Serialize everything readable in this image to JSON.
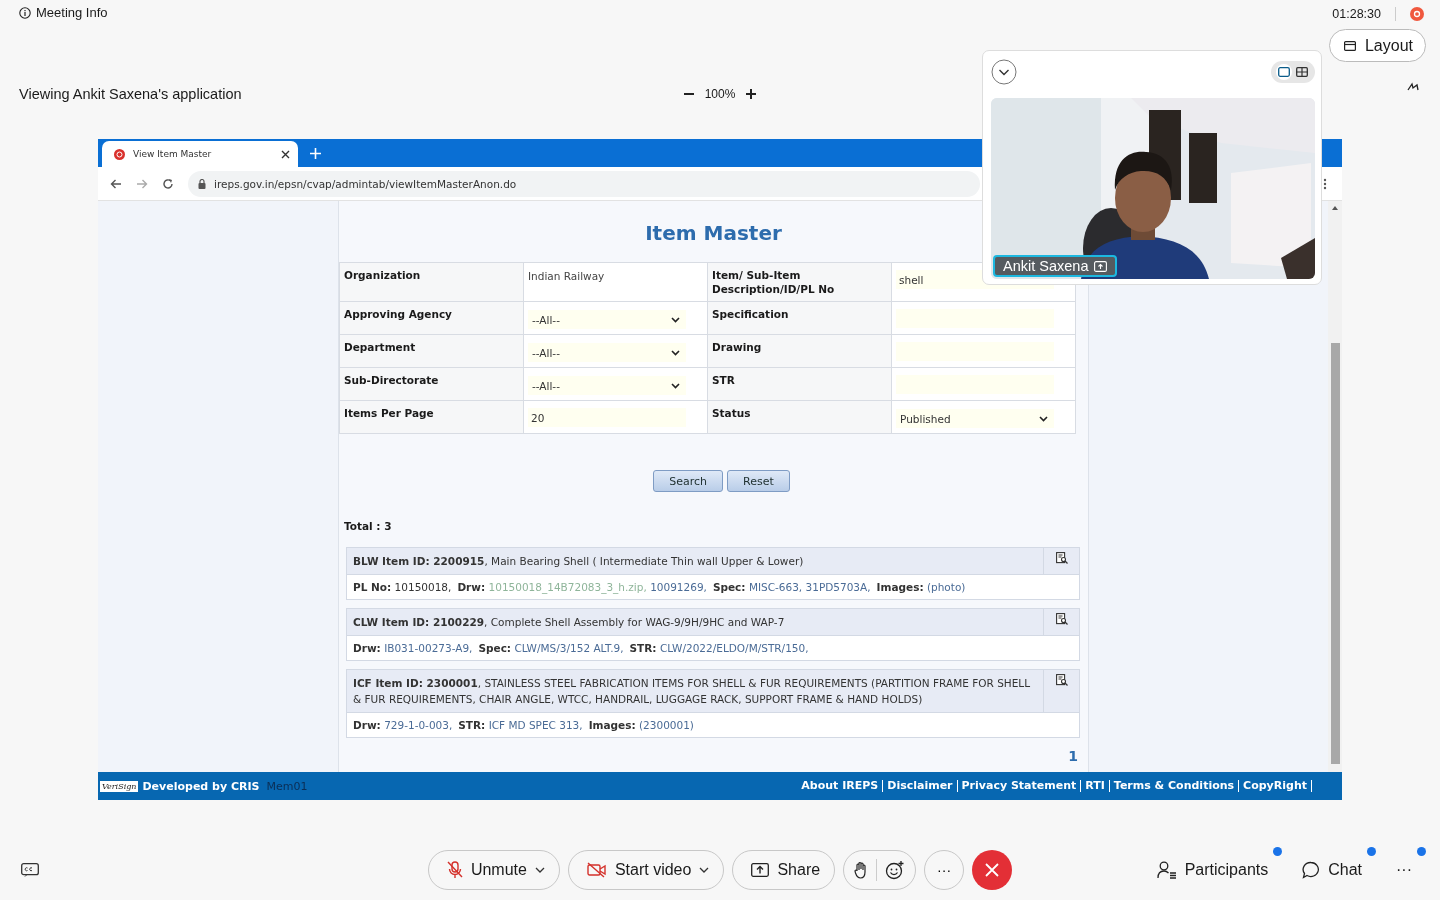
{
  "meeting": {
    "info": "Meeting Info",
    "timer": "01:28:30",
    "recording": true,
    "layout_button": "Layout",
    "viewing": "Viewing Ankit Saxena's application",
    "zoom": "100%"
  },
  "browser": {
    "tab_title": "View Item Master",
    "url": "ireps.gov.in/epsn/cvap/admintab/viewItemMasterAnon.do"
  },
  "page": {
    "title": "Item Master",
    "form": [
      {
        "cells": [
          {
            "label": "Organization",
            "field": {
              "kind": "text",
              "value": "Indian Railway"
            }
          },
          {
            "label": "Item/ Sub-Item Description/ID/PL No",
            "field": {
              "kind": "input",
              "value": "shell"
            }
          }
        ]
      },
      {
        "cells": [
          {
            "label": "Approving Agency",
            "field": {
              "kind": "select",
              "value": "--All--"
            }
          },
          {
            "label": "Specification",
            "field": {
              "kind": "input"
            }
          }
        ]
      },
      {
        "cells": [
          {
            "label": "Department",
            "field": {
              "kind": "select",
              "value": "--All--"
            }
          },
          {
            "label": "Drawing",
            "field": {
              "kind": "input"
            }
          }
        ]
      },
      {
        "cells": [
          {
            "label": "Sub-Directorate",
            "field": {
              "kind": "select",
              "value": "--All--"
            }
          },
          {
            "label": "STR",
            "field": {
              "kind": "input"
            }
          }
        ]
      },
      {
        "cells": [
          {
            "label": "Items Per Page",
            "field": {
              "kind": "input",
              "value": "20"
            }
          },
          {
            "label": "Status",
            "field": {
              "kind": "select",
              "value": "Published"
            }
          }
        ]
      }
    ],
    "buttons": [
      "Search",
      "Reset"
    ],
    "total": "Total : 3",
    "results": [
      {
        "title": "**BLW Item ID: 2200915**,  Main Bearing Shell ( Intermediate Thin wall Upper & Lower)",
        "details": [
          {
            "label": "PL No:",
            "values": [
              {
                "text": "10150018,",
                "kind": "text"
              }
            ]
          },
          {
            "label": "Drw:",
            "values": [
              {
                "text": "10150018_14B72083_3_h.zip,",
                "kind": "visited"
              },
              {
                "text": "10091269,",
                "kind": "link"
              }
            ]
          },
          {
            "label": "Spec:",
            "values": [
              {
                "text": "MISC-663,",
                "kind": "link"
              },
              {
                "text": "31PD5703A,",
                "kind": "link"
              }
            ]
          },
          {
            "label": "Images:",
            "values": [
              {
                "text": "(photo)",
                "kind": "link"
              }
            ]
          }
        ]
      },
      {
        "title": "**CLW Item ID: 2100229**,  Complete Shell Assembly for WAG-9/9H/9HC and WAP-7",
        "details": [
          {
            "label": "Drw:",
            "values": [
              {
                "text": "IB031-00273-A9,",
                "kind": "link"
              }
            ]
          },
          {
            "label": "Spec:",
            "values": [
              {
                "text": "CLW/MS/3/152 ALT.9,",
                "kind": "link"
              }
            ]
          },
          {
            "label": "STR:",
            "values": [
              {
                "text": "CLW/2022/ELDO/M/STR/150,",
                "kind": "link"
              }
            ]
          }
        ]
      },
      {
        "title": "**ICF Item ID: 2300001**,  STAINLESS STEEL FABRICATION ITEMS FOR SHELL & FUR REQUIREMENTS (PARTITION FRAME FOR SHELL & FUR REQUIREMENTS, CHAIR ANGLE, WTCC, HANDRAIL, LUGGAGE RACK, SUPPORT FRAME & HAND HOLDS)",
        "details": [
          {
            "label": "Drw:",
            "values": [
              {
                "text": "729-1-0-003,",
                "kind": "link"
              }
            ]
          },
          {
            "label": "STR:",
            "values": [
              {
                "text": "ICF MD SPEC 313,",
                "kind": "link"
              }
            ]
          },
          {
            "label": "Images:",
            "values": [
              {
                "text": "(2300001)",
                "kind": "link"
              }
            ]
          }
        ]
      }
    ],
    "pagination": "1"
  },
  "footer": {
    "logo": "VeriSign",
    "developer": "Developed by CRIS",
    "user": "Mem01",
    "links": [
      "About IREPS",
      "Disclaimer",
      "Privacy Statement",
      "RTI",
      "Terms & Conditions",
      "CopyRight"
    ]
  },
  "video": {
    "name": "Ankit Saxena",
    "views": [
      {
        "kind": "single",
        "selected": true
      },
      {
        "kind": "grid",
        "selected": false
      }
    ]
  },
  "controls": {
    "buttons": [
      {
        "kind": "mute",
        "label": "Unmute",
        "caret": true
      },
      {
        "kind": "video",
        "label": "Start video",
        "caret": true
      },
      {
        "kind": "share",
        "label": "Share",
        "caret": false
      }
    ],
    "more": "···",
    "side": [
      {
        "kind": "participants",
        "label": "Participants",
        "badge": true
      },
      {
        "kind": "chat",
        "label": "Chat",
        "badge": true
      },
      {
        "kind": "more",
        "label": "···",
        "badge": true
      }
    ]
  }
}
